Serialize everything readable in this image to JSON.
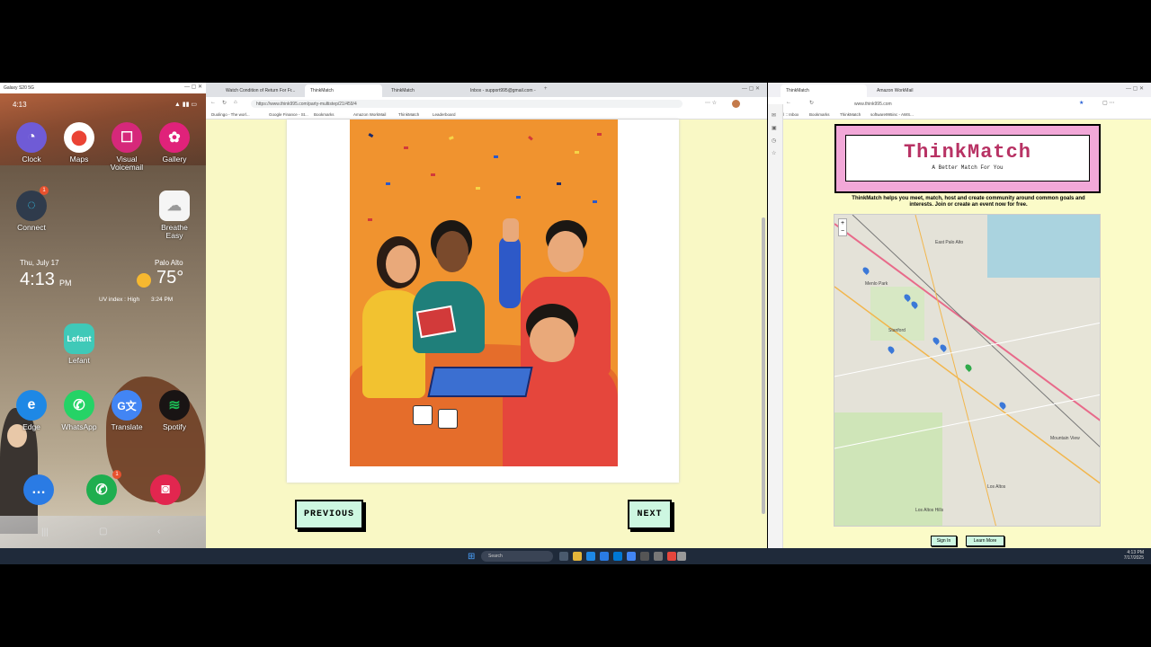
{
  "phone": {
    "window_title": "Galaxy S20 5G",
    "time": "4:13",
    "widget_date": "Thu, July 17",
    "widget_time": "4:13",
    "widget_ampm": "PM",
    "weather_location": "Palo Alto",
    "weather_temp": "75°",
    "weather_detail": "UV index : High",
    "weather_updated": "3:24 PM",
    "apps": [
      {
        "label": "Clock",
        "icon": "clock-icon",
        "color": "#6f5bd6"
      },
      {
        "label": "Maps",
        "icon": "maps-icon",
        "color": "#ffffff"
      },
      {
        "label": "Visual Voicemail",
        "icon": "voicemail-icon",
        "color": "#d6287a"
      },
      {
        "label": "Gallery",
        "icon": "gallery-icon",
        "color": "#e0227a"
      },
      {
        "label": "Connect",
        "icon": "connect-icon",
        "color": "#2f3b4c"
      },
      {
        "label": "Breathe Easy",
        "icon": "breathe-icon",
        "color": "#f5f5f5"
      },
      {
        "label": "Lefant",
        "icon": "lefant-icon",
        "color": "#3fc9b8",
        "text": "Lefant"
      },
      {
        "label": "Edge",
        "icon": "edge-icon",
        "color": "#1e88e5"
      },
      {
        "label": "WhatsApp",
        "icon": "whatsapp-icon",
        "color": "#25d366"
      },
      {
        "label": "Translate",
        "icon": "translate-icon",
        "color": "#4285f4"
      },
      {
        "label": "Spotify",
        "icon": "spotify-icon",
        "color": "#191414"
      }
    ],
    "dock": [
      {
        "icon": "messages-icon",
        "color": "#2a7be4"
      },
      {
        "icon": "phone-icon",
        "color": "#1fae4f"
      },
      {
        "icon": "camera-icon",
        "color": "#e2264f"
      }
    ],
    "badge": "1"
  },
  "browser1": {
    "tabs": [
      "Watch Condition of Return For Fr...",
      "ThinkMatch",
      "ThinkMatch",
      "Inbox - support995@gmail.com -"
    ],
    "url": "https://www.think995.com/party-multistep/21/459/4",
    "bookmarks": [
      "Duolingo - The worl...",
      "Google Finance - St...",
      "Bookmarks",
      "Amazon WorkMail",
      "ThinkMatch",
      "Leaderboard"
    ],
    "prev_label": "PREVIOUS",
    "next_label": "NEXT"
  },
  "browser2": {
    "tabs": [
      "ThinkMatch",
      "Amazon WorkMail"
    ],
    "url": "www.think995.com",
    "bookmarks": [
      "Mail :: Inbox",
      "Bookmarks",
      "ThinkMatch",
      "software995inc - AWS..."
    ],
    "brand": "ThinkMatch",
    "tagline": "A Better Match For You",
    "blurb": "ThinkMatch helps you meet, match, host and create community around common goals and interests. Join or create an event now for free.",
    "map_labels": [
      "East Palo Alto",
      "Menlo Park",
      "Stanford",
      "Mountain View",
      "Los Altos",
      "Los Altos Hills"
    ],
    "signin_label": "Sign In",
    "learnmore_label": "Learn More"
  },
  "taskbar": {
    "search_placeholder": "Search",
    "clock_time": "4:13 PM",
    "clock_date": "7/17/2025"
  }
}
